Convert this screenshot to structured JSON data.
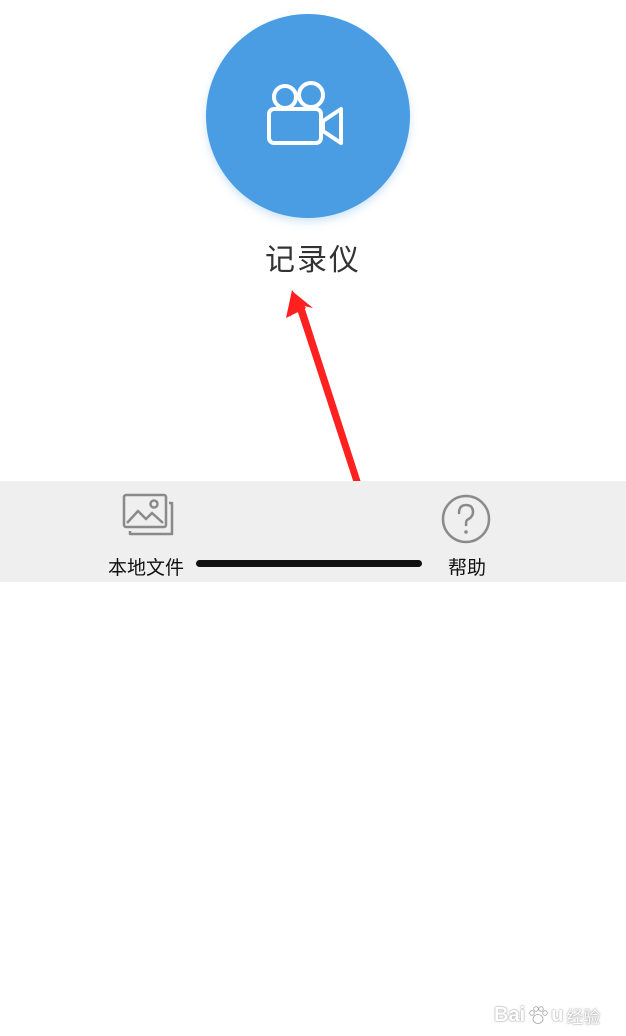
{
  "main": {
    "recorder_label": "记录仪",
    "recorder_icon": "video-camera-icon",
    "accent_color": "#4a9de3"
  },
  "bottom_bar": {
    "tabs": [
      {
        "label": "本地文件",
        "icon": "image-gallery-icon"
      },
      {
        "label": "帮助",
        "icon": "help-question-icon"
      }
    ]
  },
  "watermark": {
    "brand_left": "Bai",
    "brand_right": "u",
    "suffix": "经验"
  },
  "annotation": {
    "arrow_color": "#ff2020"
  }
}
